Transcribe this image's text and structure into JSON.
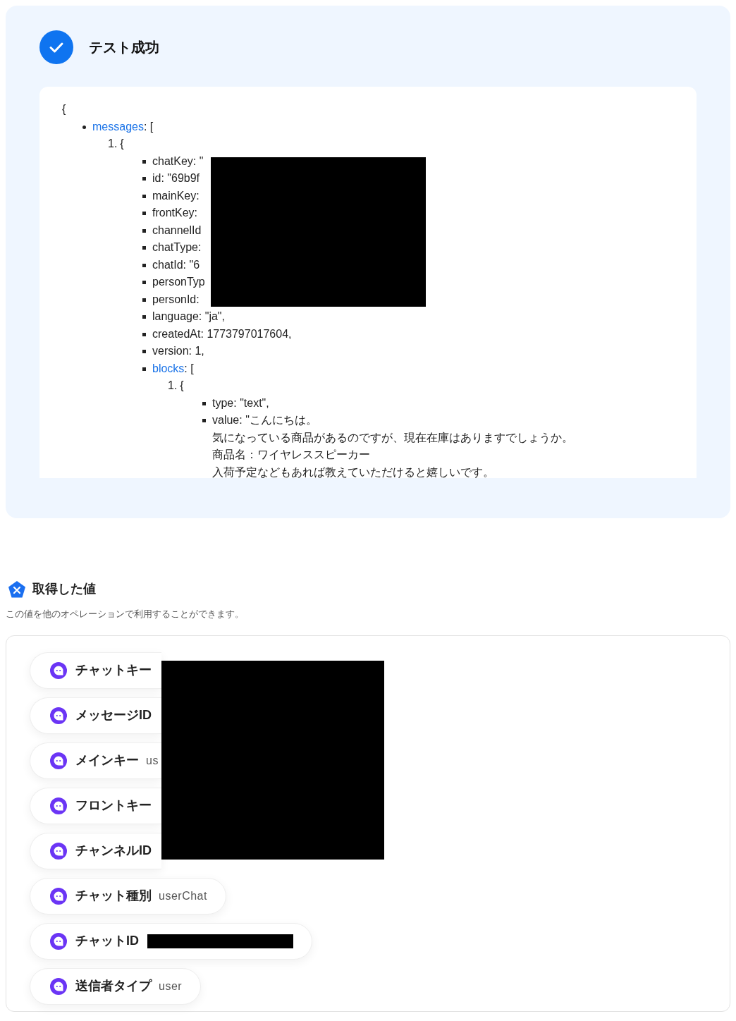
{
  "test_result": {
    "title": "テスト成功",
    "json_view": {
      "text": "{",
      "children": [
        {
          "key": "messages",
          "text": ": [",
          "kind": "disc",
          "children": [
            {
              "number": "1.",
              "text": "{",
              "kind": "numbered",
              "children": [
                {
                  "text": "chatKey: \"",
                  "kind": "square"
                },
                {
                  "text": "id: \"69b9f",
                  "kind": "square"
                },
                {
                  "text": "mainKey:",
                  "kind": "square"
                },
                {
                  "text": "frontKey:",
                  "kind": "square"
                },
                {
                  "text": "channelId",
                  "kind": "square"
                },
                {
                  "text": "chatType:",
                  "kind": "square"
                },
                {
                  "text": "chatId: \"6",
                  "kind": "square"
                },
                {
                  "text": "personTyp",
                  "kind": "square"
                },
                {
                  "text": "personId:",
                  "kind": "square"
                },
                {
                  "text": "language: \"ja\",",
                  "kind": "square"
                },
                {
                  "text": "createdAt: 1773797017604,",
                  "kind": "square"
                },
                {
                  "text": "version: 1,",
                  "kind": "square"
                },
                {
                  "key": "blocks",
                  "text": ": [",
                  "kind": "square",
                  "children": [
                    {
                      "number": "1.",
                      "text": "{",
                      "kind": "numbered",
                      "children": [
                        {
                          "text": "type: \"text\",",
                          "kind": "square"
                        },
                        {
                          "lines": [
                            "value: \"こんにちは。",
                            "気になっている商品があるのですが、現在在庫はありますでしょうか。",
                            "商品名：ワイヤレススピーカー",
                            "入荷予定などもあれば教えていただけると嬉しいです。"
                          ],
                          "kind": "square"
                        }
                      ]
                    }
                  ]
                }
              ]
            }
          ]
        }
      ]
    }
  },
  "obtained_values": {
    "title": "取得した値",
    "description": "この値を他のオペレーションで利用することができます。",
    "covered_items": [
      {
        "label": "チャットキー"
      },
      {
        "label": "メッセージID"
      },
      {
        "label": "メインキー",
        "value": "us"
      },
      {
        "label": "フロントキー"
      },
      {
        "label": "チャンネルID"
      }
    ],
    "items": [
      {
        "label": "チャット種別",
        "value": "userChat",
        "value_redacted": false
      },
      {
        "label": "チャットID",
        "value_redacted": true
      },
      {
        "label": "送信者タイプ",
        "value": "user",
        "value_redacted": false
      }
    ]
  }
}
